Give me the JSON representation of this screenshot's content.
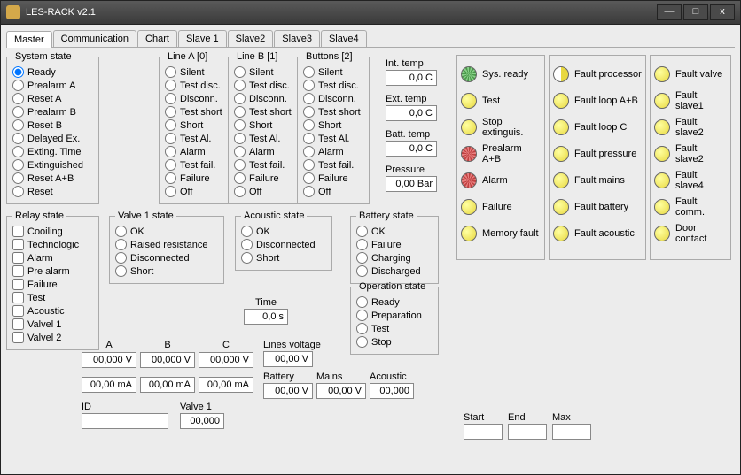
{
  "window": {
    "title": "LES-RACK  v2.1",
    "min": "—",
    "max": "□",
    "close": "x"
  },
  "tabs": [
    "Master",
    "Communication",
    "Chart",
    "Slave 1",
    "Slave2",
    "Slave3",
    "Slave4"
  ],
  "system_state": {
    "legend": "System state",
    "items": [
      "Ready",
      "Prealarm A",
      "Reset A",
      "Prealarm B",
      "Reset B",
      "Delayed Ex.",
      "Exting. Time",
      "Extinguished",
      "Reset A+B",
      "Reset"
    ]
  },
  "line_a": {
    "legend": "Line A [0]",
    "items": [
      "Silent",
      "Test disc.",
      "Disconn.",
      "Test short",
      "Short",
      "Test Al.",
      "Alarm",
      "Test fail.",
      "Failure",
      "Off"
    ]
  },
  "line_b": {
    "legend": "Line B [1]",
    "items": [
      "Silent",
      "Test disc.",
      "Disconn.",
      "Test short",
      "Short",
      "Test Al.",
      "Alarm",
      "Test fail.",
      "Failure",
      "Off"
    ]
  },
  "buttons": {
    "legend": "Buttons [2]",
    "items": [
      "Silent",
      "Test disc.",
      "Disconn.",
      "Test short",
      "Short",
      "Test Al.",
      "Alarm",
      "Test fail.",
      "Failure",
      "Off"
    ]
  },
  "relay": {
    "legend": "Relay  state",
    "items": [
      "Cooiling",
      "Technologic",
      "Alarm",
      "Pre alarm",
      "Failure",
      "Test",
      "Acoustic",
      "Valvel 1",
      "Valvel 2"
    ]
  },
  "valve1": {
    "legend": "Valve 1 state",
    "items": [
      "OK",
      "Raised resistance",
      "Disconnected",
      "Short"
    ]
  },
  "acoustic": {
    "legend": "Acoustic state",
    "items": [
      "OK",
      "Disconnected",
      "Short"
    ]
  },
  "battery": {
    "legend": "Battery state",
    "items": [
      "OK",
      "Failure",
      "Charging",
      "Discharged"
    ]
  },
  "operation": {
    "legend": "Operation state",
    "items": [
      "Ready",
      "Preparation",
      "Test",
      "Stop"
    ]
  },
  "sensors": {
    "int": {
      "label": "Int. temp",
      "val": "0,0 C"
    },
    "ext": {
      "label": "Ext. temp",
      "val": "0,0 C"
    },
    "batt": {
      "label": "Batt. temp",
      "val": "0,0 C"
    },
    "pres": {
      "label": "Pressure",
      "val": "0,00 Bar"
    }
  },
  "time": {
    "label": "Time",
    "val": "0,0 s"
  },
  "cols": {
    "A": "A",
    "B": "B",
    "C": "C"
  },
  "volts": [
    "00,000 V",
    "00,000 V",
    "00,000 V"
  ],
  "amps": [
    "00,00 mA",
    "00,00 mA",
    "00,00 mA"
  ],
  "lines_voltage": {
    "label": "Lines voltage",
    "val": "00,00 V"
  },
  "bma": {
    "battery": {
      "label": "Battery",
      "val": "00,00 V"
    },
    "mains": {
      "label": "Mains",
      "val": "00,00 V"
    },
    "acoustic": {
      "label": "Acoustic",
      "val": "00,000"
    }
  },
  "id": {
    "label": "ID",
    "val": ""
  },
  "valve1_val": {
    "label": "Valve 1",
    "val": "00,000"
  },
  "range": {
    "start": "Start",
    "end": "End",
    "max": "Max"
  },
  "ind1": [
    [
      "g",
      "Sys. ready"
    ],
    [
      "y",
      "Test"
    ],
    [
      "y",
      "Stop extinguis."
    ],
    [
      "r",
      "Prealarm A+B"
    ],
    [
      "r",
      "Alarm"
    ],
    [
      "y",
      "Failure"
    ],
    [
      "y",
      "Memory fault"
    ]
  ],
  "ind2": [
    [
      "yh",
      "Fault processor"
    ],
    [
      "y",
      "Fault loop A+B"
    ],
    [
      "y",
      "Fault loop C"
    ],
    [
      "y",
      "Fault pressure"
    ],
    [
      "y",
      "Fault mains"
    ],
    [
      "y",
      "Fault battery"
    ],
    [
      "y",
      "Fault acoustic"
    ]
  ],
  "ind3": [
    [
      "y",
      "Fault valve"
    ],
    [
      "y",
      "Fault slave1"
    ],
    [
      "y",
      "Fault slave2"
    ],
    [
      "y",
      "Fault slave2"
    ],
    [
      "y",
      "Fault slave4"
    ],
    [
      "y",
      "Fault comm."
    ],
    [
      "y",
      "Door contact"
    ]
  ]
}
